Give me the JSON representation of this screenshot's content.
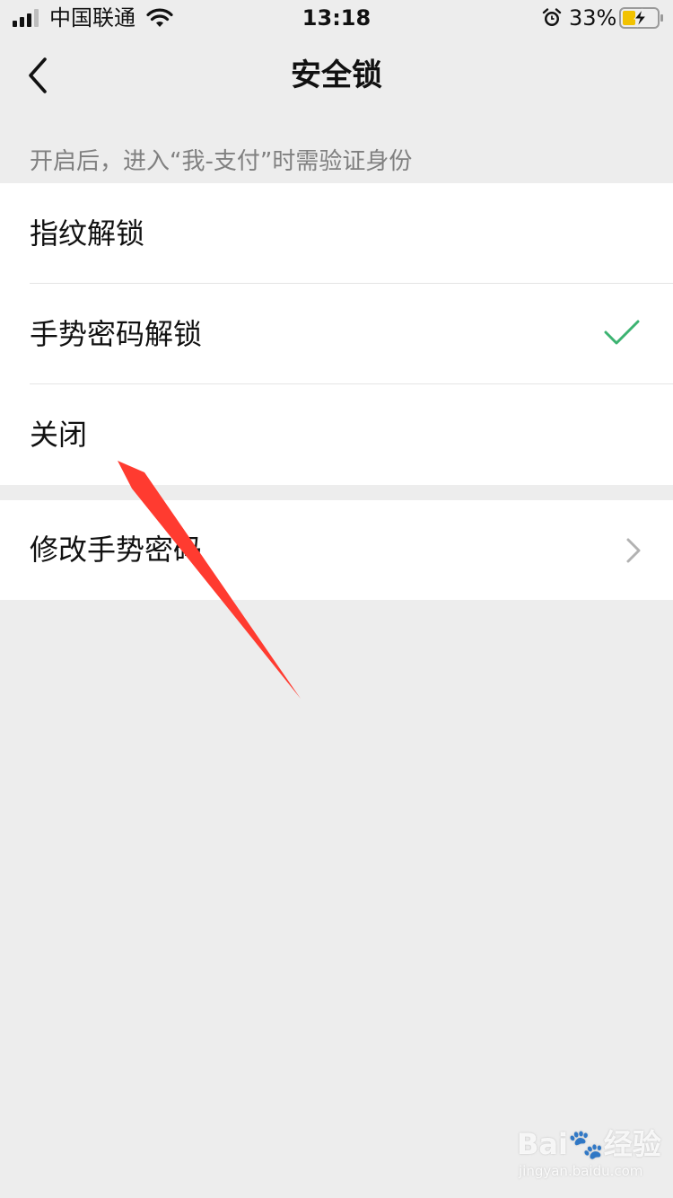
{
  "status_bar": {
    "carrier": "中国联通",
    "time": "13:18",
    "battery_percent": "33%",
    "signal_bars": 4,
    "battery_level": 0.33
  },
  "nav": {
    "back_icon": "chevron-left-icon",
    "title": "安全锁"
  },
  "hint": "开启后，进入“我-支付”时需验证身份",
  "lock_options": [
    {
      "label": "指纹解锁",
      "selected": false
    },
    {
      "label": "手势密码解锁",
      "selected": true
    },
    {
      "label": "关闭",
      "selected": false
    }
  ],
  "modify": {
    "label": "修改手势密码",
    "icon": "chevron-right-icon"
  },
  "colors": {
    "background": "#ededed",
    "cell": "#ffffff",
    "check": "#3cb371",
    "annotation": "#ff3b30",
    "secondary_text": "#808080"
  },
  "watermark": {
    "main": "Bai🐾经验",
    "sub": "jingyan.baidu.com"
  }
}
